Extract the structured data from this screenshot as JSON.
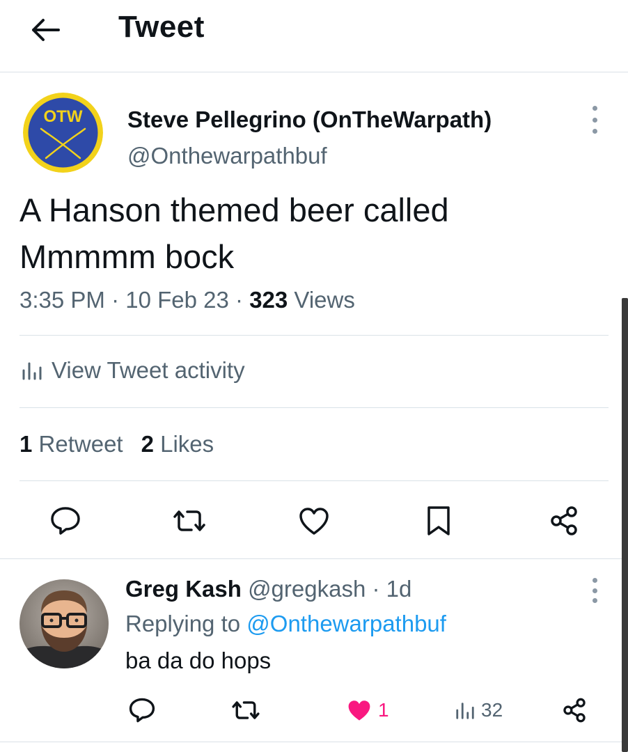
{
  "header": {
    "title": "Tweet"
  },
  "tweet": {
    "author_name": "Steve Pellegrino (OnTheWarpath)",
    "author_handle": "@Onthewarpathbuf",
    "avatar_text": "OTW",
    "text_line1": "A Hanson themed beer called",
    "text_line2": "Mmmmm bock",
    "time": "3:35 PM",
    "date": "10 Feb 23",
    "views_count": "323",
    "views_label": "Views",
    "activity_label": "View Tweet activity",
    "retweets_count": "1",
    "retweets_label": "Retweet",
    "likes_count": "2",
    "likes_label": "Likes"
  },
  "reply": {
    "name": "Greg Kash",
    "handle": "@gregkash",
    "age": "1d",
    "replying_prefix": "Replying to",
    "replying_handle": "@Onthewarpathbuf",
    "text": "ba da do hops",
    "like_count": "1",
    "views_count": "32"
  },
  "colors": {
    "accent": "#1d9bf0",
    "like": "#f91880",
    "muted": "#536471",
    "divider": "#d9e1e7",
    "otw_yellow": "#f2d21b",
    "otw_blue": "#2e4aa8"
  },
  "icons": [
    "back-arrow-icon",
    "more-icon",
    "bar-chart-icon",
    "reply-icon",
    "retweet-icon",
    "like-icon",
    "bookmark-icon",
    "share-icon",
    "liked-heart-icon",
    "views-icon"
  ]
}
